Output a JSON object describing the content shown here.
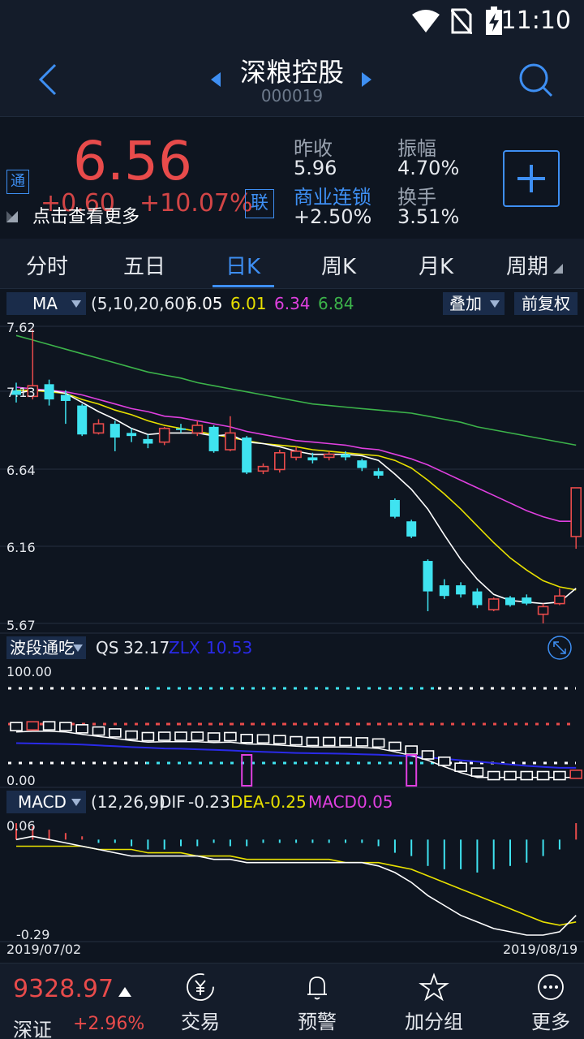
{
  "status": {
    "time": "11:10"
  },
  "header": {
    "title": "深粮控股",
    "code": "000019"
  },
  "quote": {
    "price": "6.56",
    "change": "+0.60",
    "change_pct": "+10.07%",
    "tong": "通",
    "lian": "联",
    "hint": "点击查看更多",
    "prev_close_label": "昨收",
    "prev_close": "5.96",
    "amplitude_label": "振幅",
    "amplitude": "4.70%",
    "sector_label": "商业连锁",
    "sector_change": "+2.50%",
    "turnover_label": "换手",
    "turnover": "3.51%"
  },
  "tabs": [
    "分时",
    "五日",
    "日K",
    "周K",
    "月K",
    "周期"
  ],
  "ma": {
    "name": "MA",
    "params": "(5,10,20,60)",
    "v5": "6.05",
    "v10": "6.01",
    "v20": "6.34",
    "v60": "6.84",
    "overlay": "叠加",
    "adjust": "前复权"
  },
  "price_axis": [
    "7.62",
    "7.13",
    "6.64",
    "6.16",
    "5.67"
  ],
  "qs": {
    "name": "波段通吃",
    "qs_label": "QS",
    "qs_val": "32.17",
    "zlx_label": "ZLX",
    "zlx_val": "10.53",
    "top": "100.00",
    "bottom": "0.00"
  },
  "macd": {
    "name": "MACD",
    "params": "(12,26,9)",
    "dif_label": "DIF",
    "dif": "-0.23",
    "dea_label": "DEA",
    "dea": "-0.25",
    "macd_label": "MACD",
    "macd": "0.05",
    "top": "0.06",
    "bottom": "-0.29"
  },
  "dates": {
    "start": "2019/07/02",
    "end": "2019/08/19"
  },
  "bottom": {
    "index_value": "9328.97",
    "index_name": "深证",
    "index_change": "+2.96%",
    "nav": [
      "交易",
      "预警",
      "加分组",
      "更多"
    ]
  },
  "colors": {
    "up": "#e84b4b",
    "down": "#3fe3f0",
    "accent": "#3e8ff3",
    "ma5": "#ffffff",
    "ma10": "#e8e000",
    "ma20": "#e040e0",
    "ma60": "#3cb34a"
  },
  "chart_data": {
    "type": "candlestick",
    "ylim": [
      5.67,
      7.62
    ],
    "candles": [
      {
        "o": 7.2,
        "c": 7.17,
        "h": 7.25,
        "l": 7.12
      },
      {
        "o": 7.16,
        "c": 7.23,
        "h": 7.6,
        "l": 7.14
      },
      {
        "o": 7.24,
        "c": 7.14,
        "h": 7.27,
        "l": 7.1
      },
      {
        "o": 7.17,
        "c": 7.13,
        "h": 7.2,
        "l": 6.98
      },
      {
        "o": 7.1,
        "c": 6.91,
        "h": 7.11,
        "l": 6.9
      },
      {
        "o": 6.92,
        "c": 6.98,
        "h": 7.01,
        "l": 6.91
      },
      {
        "o": 6.98,
        "c": 6.89,
        "h": 7.0,
        "l": 6.8
      },
      {
        "o": 6.92,
        "c": 6.9,
        "h": 6.95,
        "l": 6.86
      },
      {
        "o": 6.88,
        "c": 6.85,
        "h": 6.91,
        "l": 6.82
      },
      {
        "o": 6.86,
        "c": 6.95,
        "h": 6.96,
        "l": 6.84
      },
      {
        "o": 6.95,
        "c": 6.94,
        "h": 6.98,
        "l": 6.92
      },
      {
        "o": 6.92,
        "c": 6.97,
        "h": 7.0,
        "l": 6.9
      },
      {
        "o": 6.96,
        "c": 6.8,
        "h": 6.97,
        "l": 6.79
      },
      {
        "o": 6.81,
        "c": 6.92,
        "h": 7.03,
        "l": 6.8
      },
      {
        "o": 6.89,
        "c": 6.66,
        "h": 6.9,
        "l": 6.65
      },
      {
        "o": 6.67,
        "c": 6.7,
        "h": 6.72,
        "l": 6.65
      },
      {
        "o": 6.68,
        "c": 6.79,
        "h": 6.81,
        "l": 6.66
      },
      {
        "o": 6.76,
        "c": 6.8,
        "h": 6.83,
        "l": 6.74
      },
      {
        "o": 6.76,
        "c": 6.74,
        "h": 6.79,
        "l": 6.72
      },
      {
        "o": 6.76,
        "c": 6.78,
        "h": 6.8,
        "l": 6.74
      },
      {
        "o": 6.78,
        "c": 6.76,
        "h": 6.8,
        "l": 6.74
      },
      {
        "o": 6.74,
        "c": 6.69,
        "h": 6.75,
        "l": 6.67
      },
      {
        "o": 6.67,
        "c": 6.64,
        "h": 6.69,
        "l": 6.62
      },
      {
        "o": 6.48,
        "c": 6.37,
        "h": 6.49,
        "l": 6.36
      },
      {
        "o": 6.34,
        "c": 6.24,
        "h": 6.35,
        "l": 6.23
      },
      {
        "o": 6.08,
        "c": 5.88,
        "h": 6.09,
        "l": 5.75
      },
      {
        "o": 5.92,
        "c": 5.85,
        "h": 5.96,
        "l": 5.83
      },
      {
        "o": 5.92,
        "c": 5.86,
        "h": 5.94,
        "l": 5.84
      },
      {
        "o": 5.88,
        "c": 5.79,
        "h": 5.9,
        "l": 5.77
      },
      {
        "o": 5.76,
        "c": 5.83,
        "h": 5.84,
        "l": 5.75
      },
      {
        "o": 5.84,
        "c": 5.79,
        "h": 5.85,
        "l": 5.78
      },
      {
        "o": 5.84,
        "c": 5.8,
        "h": 5.86,
        "l": 5.79
      },
      {
        "o": 5.73,
        "c": 5.78,
        "h": 5.8,
        "l": 5.67
      },
      {
        "o": 5.8,
        "c": 5.85,
        "h": 5.9,
        "l": 5.79
      },
      {
        "o": 6.24,
        "c": 6.56,
        "h": 6.56,
        "l": 6.16
      }
    ],
    "ma5": [
      7.18,
      7.2,
      7.2,
      7.18,
      7.12,
      7.06,
      7.01,
      6.95,
      6.91,
      6.92,
      6.92,
      6.92,
      6.9,
      6.91,
      6.86,
      6.85,
      6.83,
      6.8,
      6.78,
      6.78,
      6.78,
      6.77,
      6.74,
      6.65,
      6.55,
      6.42,
      6.25,
      6.09,
      5.96,
      5.86,
      5.82,
      5.81,
      5.8,
      5.81,
      5.9
    ],
    "ma10": [
      7.2,
      7.2,
      7.19,
      7.18,
      7.14,
      7.11,
      7.07,
      7.04,
      7.0,
      6.97,
      6.95,
      6.93,
      6.91,
      6.89,
      6.87,
      6.85,
      6.84,
      6.83,
      6.81,
      6.8,
      6.79,
      6.78,
      6.77,
      6.74,
      6.69,
      6.61,
      6.52,
      6.42,
      6.31,
      6.2,
      6.1,
      6.02,
      5.95,
      5.91,
      5.89
    ],
    "ma20": [
      7.22,
      7.21,
      7.2,
      7.19,
      7.17,
      7.14,
      7.11,
      7.08,
      7.06,
      7.03,
      7.02,
      7.0,
      6.98,
      6.96,
      6.93,
      6.91,
      6.89,
      6.87,
      6.86,
      6.85,
      6.84,
      6.82,
      6.81,
      6.78,
      6.75,
      6.71,
      6.66,
      6.61,
      6.56,
      6.51,
      6.46,
      6.41,
      6.37,
      6.34,
      6.34
    ],
    "ma60": [
      7.56,
      7.53,
      7.5,
      7.47,
      7.44,
      7.41,
      7.38,
      7.35,
      7.32,
      7.3,
      7.28,
      7.25,
      7.23,
      7.21,
      7.19,
      7.17,
      7.15,
      7.13,
      7.11,
      7.1,
      7.09,
      7.08,
      7.07,
      7.06,
      7.05,
      7.03,
      7.01,
      6.99,
      6.96,
      6.94,
      6.92,
      6.9,
      6.88,
      6.86,
      6.84
    ],
    "macd_bars": [
      0.05,
      0.04,
      0.03,
      0.02,
      0.01,
      -0.01,
      -0.01,
      -0.02,
      -0.03,
      -0.03,
      -0.02,
      -0.02,
      -0.01,
      -0.02,
      -0.02,
      -0.01,
      -0.01,
      -0.01,
      -0.01,
      -0.01,
      -0.01,
      -0.01,
      -0.02,
      -0.04,
      -0.05,
      -0.08,
      -0.09,
      -0.09,
      -0.1,
      -0.09,
      -0.08,
      -0.07,
      -0.05,
      -0.03,
      0.05
    ],
    "dif": [
      0.0,
      0.01,
      0.0,
      -0.01,
      -0.02,
      -0.03,
      -0.04,
      -0.05,
      -0.05,
      -0.05,
      -0.05,
      -0.05,
      -0.06,
      -0.06,
      -0.07,
      -0.07,
      -0.07,
      -0.07,
      -0.07,
      -0.07,
      -0.07,
      -0.07,
      -0.08,
      -0.1,
      -0.13,
      -0.17,
      -0.2,
      -0.23,
      -0.25,
      -0.27,
      -0.28,
      -0.29,
      -0.29,
      -0.28,
      -0.23
    ],
    "dea": [
      -0.02,
      -0.02,
      -0.02,
      -0.02,
      -0.02,
      -0.03,
      -0.03,
      -0.03,
      -0.04,
      -0.04,
      -0.04,
      -0.05,
      -0.05,
      -0.05,
      -0.06,
      -0.06,
      -0.06,
      -0.06,
      -0.06,
      -0.06,
      -0.07,
      -0.07,
      -0.07,
      -0.08,
      -0.09,
      -0.11,
      -0.13,
      -0.15,
      -0.17,
      -0.19,
      -0.21,
      -0.23,
      -0.25,
      -0.26,
      -0.25
    ]
  }
}
